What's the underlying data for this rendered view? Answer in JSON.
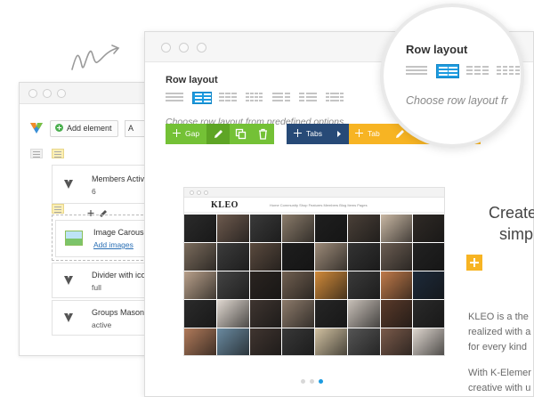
{
  "back_window": {
    "toolbar": {
      "add_element_label": "Add element",
      "more_label": "A"
    },
    "elements": [
      {
        "title": "Members Activity S",
        "sub": "6"
      },
      {
        "title": "Image Carousel",
        "link": "Add images"
      },
      {
        "title": "Divider with icon",
        "sub": "full"
      },
      {
        "title": "Groups Masonry",
        "sub": "active"
      }
    ]
  },
  "main_window": {
    "row_layout_title": "Row layout",
    "row_layout_hint": "Choose row layout from predefined options.",
    "selected_layout_index": 1,
    "toolbars": {
      "gap_label": "Gap",
      "tabs_label": "Tabs",
      "tab_label": "Tab"
    },
    "preview": {
      "logo": "KLEO",
      "nav_links": "Home   Community   Shop   Features   Members   Blog Items   Pages"
    },
    "carousel_active_dot": 2
  },
  "right_text": {
    "heading_line1": "Create",
    "heading_line2": "simpl",
    "paragraph_lines": [
      "KLEO is a the",
      "realized with a",
      "for every kind",
      "With K-Elemer",
      "creative with u"
    ]
  },
  "magnifier": {
    "title": "Row layout",
    "hint": "Choose row layout fr",
    "selected_layout_index": 1
  },
  "colors": {
    "accent_blue": "#1c9be0",
    "green": "#74c136",
    "navy": "#274a77",
    "orange": "#f7b423"
  }
}
